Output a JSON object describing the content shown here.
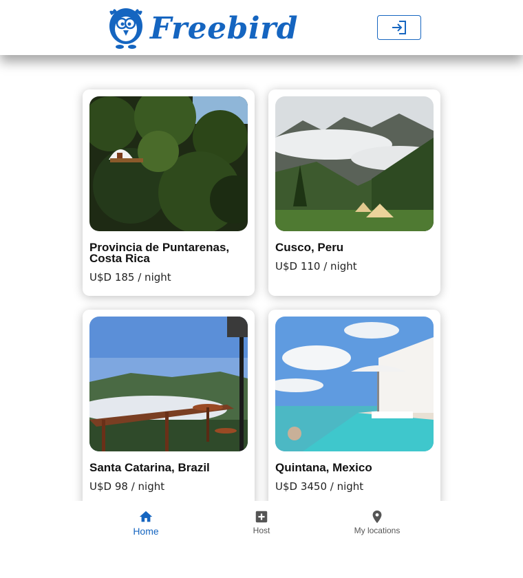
{
  "app": {
    "name": "Freebird",
    "brand_color": "#1565c0"
  },
  "header": {
    "logo_icon": "bird-logo-icon",
    "login_icon": "login-icon"
  },
  "listings": [
    {
      "title": "Provincia de Puntarenas, Costa Rica",
      "price": "U$D 185 / night"
    },
    {
      "title": "Cusco, Peru",
      "price": "U$D 110 / night"
    },
    {
      "title": "Santa Catarina, Brazil",
      "price": "U$D 98 / night"
    },
    {
      "title": "Quintana, Mexico",
      "price": "U$D 3450 / night"
    }
  ],
  "bottom_nav": {
    "items": [
      {
        "label": "Home",
        "icon": "home-icon",
        "active": true
      },
      {
        "label": "Host",
        "icon": "add-box-icon",
        "active": false
      },
      {
        "label": "My locations",
        "icon": "location-pin-icon",
        "active": false
      }
    ]
  }
}
